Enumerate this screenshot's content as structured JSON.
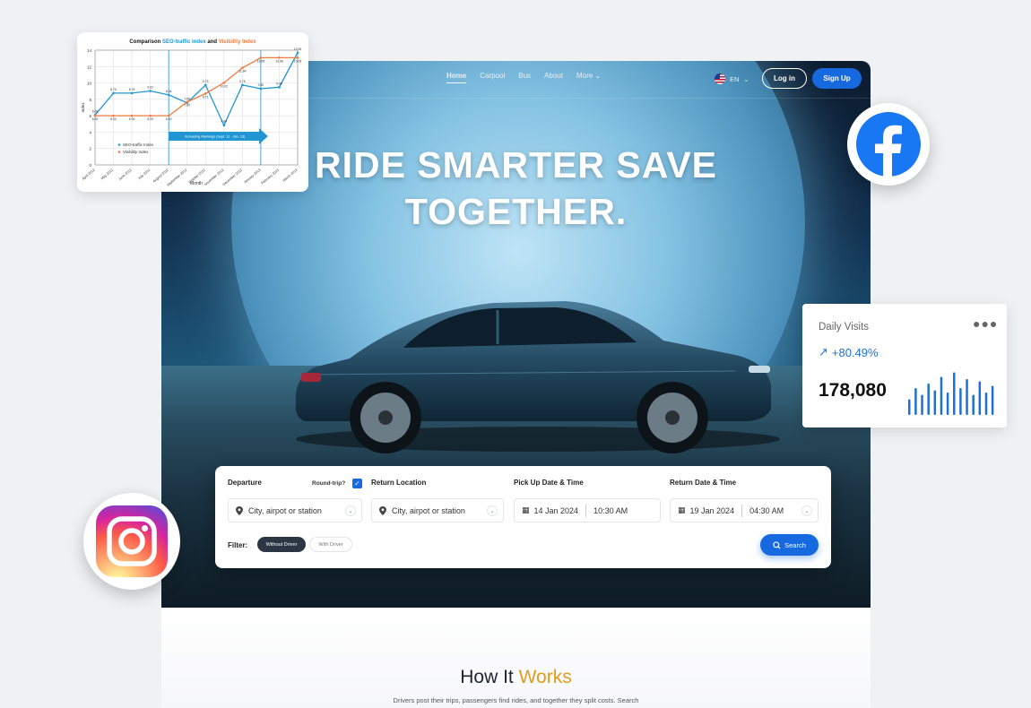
{
  "nav": {
    "items": [
      "Home",
      "Carpool",
      "Bus",
      "About",
      "More"
    ],
    "active_index": 0
  },
  "header": {
    "language": "EN",
    "login_label": "Log in",
    "signup_label": "Sign Up"
  },
  "hero": {
    "headline_line1": "RIDE SMARTER SAVE",
    "headline_line2": "TOGETHER."
  },
  "search": {
    "departure_label": "Departure",
    "round_trip_label": "Round-trip?",
    "round_trip_checked": true,
    "departure_placeholder": "City, airpot or station",
    "return_label": "Return Location",
    "return_placeholder": "City, airpot or station",
    "pickup_label": "Pick Up Date & Time",
    "pickup_date": "14 Jan 2024",
    "pickup_time": "10:30 AM",
    "return_dt_label": "Return Date & Time",
    "return_date": "19 Jan 2024",
    "return_time": "04:30 AM",
    "filter_label": "Filter:",
    "filter_options": [
      "Without Driver",
      "With Driver"
    ],
    "filter_selected": "Without Driver",
    "search_button": "Search"
  },
  "how": {
    "title_part1": "How It",
    "title_part2": "Works",
    "description": "Drivers post their trips, passengers find rides, and together they split costs. Search"
  },
  "daily_visits": {
    "title": "Daily Visits",
    "change": "+80.49%",
    "value": "178,080",
    "bars": [
      0.35,
      0.6,
      0.45,
      0.7,
      0.55,
      0.85,
      0.5,
      0.95,
      0.6,
      0.8,
      0.45,
      0.75,
      0.5,
      0.65
    ]
  },
  "chart_data": {
    "type": "line",
    "title": "Comparison SEO-traffic index and Visibility Index",
    "title_part1": "Comparison",
    "title_part2": "SEO-traffic index",
    "title_part3": "and",
    "title_part4": "Visibility Index",
    "xlabel": "Month",
    "ylabel": "Index",
    "ylim": [
      0,
      14
    ],
    "yticks": [
      0,
      2,
      4,
      6,
      8,
      10,
      12,
      14
    ],
    "categories": [
      "April 2012",
      "May 2012",
      "June 2012",
      "July 2012",
      "August 2012",
      "September 2012",
      "October 2012",
      "November 2012",
      "December 2012",
      "January 2013",
      "February 2013",
      "March 2013"
    ],
    "series": [
      {
        "name": "SEO-traffic Index",
        "color": "#2196d3",
        "values": [
          6.08,
          8.76,
          8.76,
          9.02,
          8.54,
          7.58,
          9.75,
          4.84,
          9.75,
          9.3,
          9.48,
          13.69
        ]
      },
      {
        "name": "Visibility Index",
        "color": "#f07b3f",
        "values": [
          6.0,
          6.0,
          6.0,
          6.0,
          6.0,
          7.69,
          8.71,
          10.02,
          11.84,
          13.08,
          13.08,
          13.08
        ]
      }
    ],
    "annotation": "Increasing Rankings (Sept. 11 - Jan. 13)",
    "legend_position": "bottom-left",
    "grid": true
  },
  "colors": {
    "primary": "#1769e0",
    "accent": "#e49a1d",
    "dark_pill": "#2b3544"
  },
  "icons": [
    "us-flag-icon",
    "chevron-down-icon",
    "location-pin-icon",
    "calendar-icon",
    "search-icon",
    "facebook-icon",
    "instagram-icon",
    "trend-up-arrow-icon",
    "more-dots-icon"
  ]
}
